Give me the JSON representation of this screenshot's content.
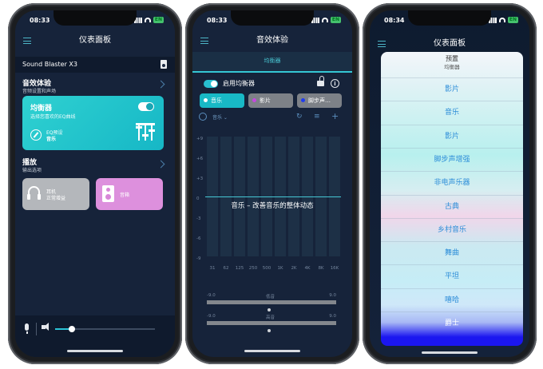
{
  "phones": [
    {
      "time": "08:33",
      "battery": "EN",
      "title": "仪表面板"
    },
    {
      "time": "08:33",
      "battery": "EN",
      "title": "音效体验"
    },
    {
      "time": "08:34",
      "battery": "EN",
      "title": "仪表面板"
    }
  ],
  "dashboard": {
    "device": "Sound Blaster X3",
    "sound_title": "音效体验",
    "sound_sub": "音频设置和声场",
    "eq_title": "均衡器",
    "eq_sub": "选择您喜欢的EQ曲线",
    "eq_preset_label": "EQ预设",
    "eq_preset_value": "音乐",
    "play_title": "播放",
    "play_sub": "输出选项",
    "headphone_title": "耳机",
    "headphone_sub": "正常增益",
    "speaker_title": "音箱",
    "volume": 0.17,
    "colors": {
      "eq_card": "#1fc4cc",
      "headphone_tile": "#b3b6ba",
      "speaker_tile": "#dd90dd",
      "accent": "#2bc3d6"
    }
  },
  "equalizer": {
    "tab": "均衡器",
    "enable_label": "启用均衡器",
    "presets": [
      {
        "label": "音乐",
        "active": true,
        "dot": "#ffffff"
      },
      {
        "label": "影片",
        "active": false,
        "dot": "#c548e0"
      },
      {
        "label": "脚步声…",
        "active": false,
        "dot": "#1f3bf0"
      }
    ],
    "current": "音乐",
    "db_labels": [
      "+9",
      "+6",
      "+3",
      "0",
      "-3",
      "-6",
      "-9"
    ],
    "bands": [
      "31",
      "62",
      "125",
      "250",
      "500",
      "1K",
      "2K",
      "4K",
      "8K",
      "16K"
    ],
    "description": "音乐 – 改善音乐的整体动态",
    "bass": {
      "label": "低音",
      "min": "-9.0",
      "max": "9.0"
    },
    "treble": {
      "label": "高音",
      "min": "-9.0",
      "max": "9.0"
    }
  },
  "preset_sheet": {
    "title": "预置",
    "subtitle": "均衡器",
    "options": [
      "影片",
      "音乐",
      "影片",
      "脚步声增强",
      "非电声乐器",
      "古典",
      "乡村音乐",
      "舞曲",
      "平坦",
      "嘻哈",
      "爵士"
    ]
  }
}
